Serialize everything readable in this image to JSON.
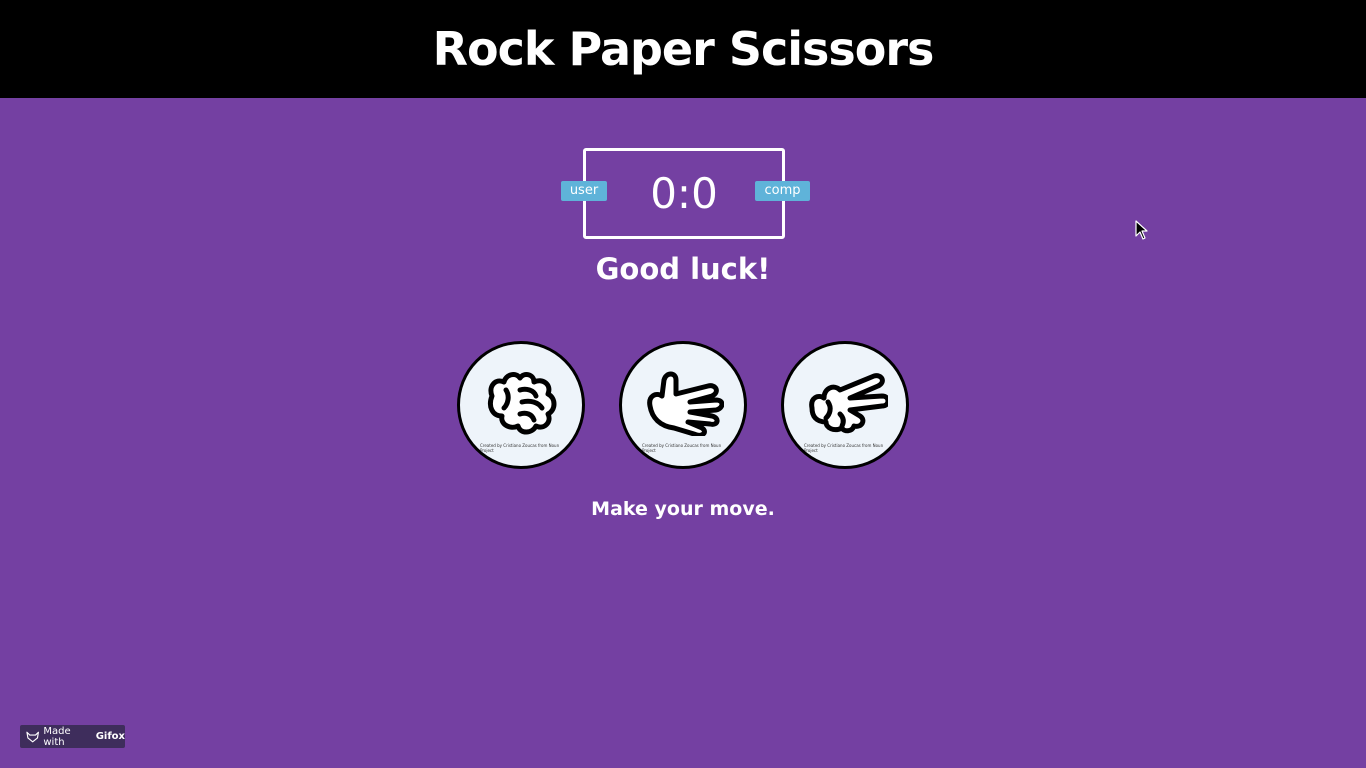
{
  "header": {
    "title": "Rock Paper Scissors"
  },
  "scoreboard": {
    "score": "0:0",
    "user_label": "user",
    "comp_label": "comp"
  },
  "result_message": "Good luck!",
  "choices": [
    {
      "name": "rock",
      "icon": "rock-hand-icon",
      "credit": "Created by Cristiano Zoucas from Noun Project"
    },
    {
      "name": "paper",
      "icon": "paper-hand-icon",
      "credit": "Created by Cristiano Zoucas from Noun Project"
    },
    {
      "name": "scissors",
      "icon": "scissors-hand-icon",
      "credit": "Created by Cristiano Zoucas from Noun Project"
    }
  ],
  "prompt": "Make your move.",
  "watermark": {
    "prefix": "Made with",
    "brand": "Gifox"
  },
  "colors": {
    "background": "#7440a2",
    "header": "#000000",
    "badge": "#5fb3d9",
    "choice_fill": "#eef4fa"
  }
}
